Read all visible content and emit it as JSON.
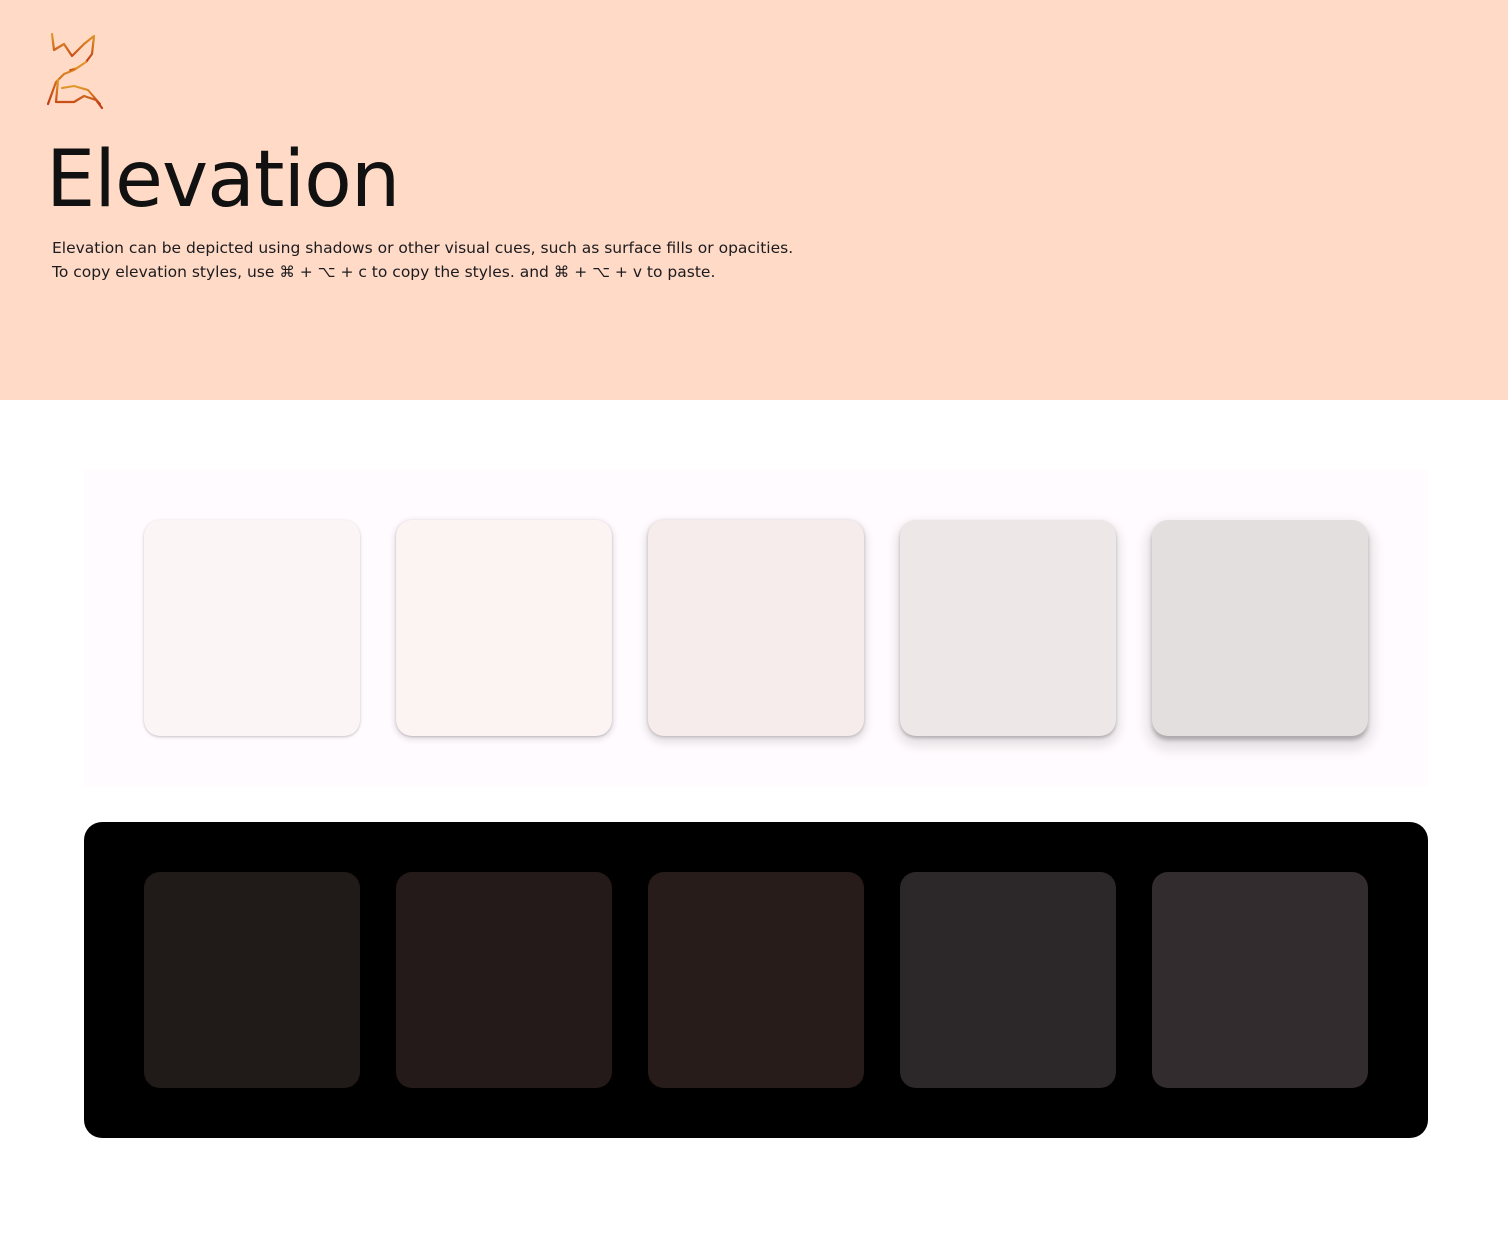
{
  "header": {
    "title": "Elevation",
    "description_line1": "Elevation can be depicted using shadows or other visual cues, such as surface fills or opacities.",
    "description_line2": "To copy elevation styles, use ⌘ + ⌥ + c to copy the styles. and ⌘ + ⌥ + v to paste.",
    "logo_icon": "fox-logo-icon",
    "background_color": "#ffdac6"
  },
  "light_panel": {
    "background_color": "#fffbfe",
    "cards": [
      {
        "color": "#fbf5f6"
      },
      {
        "color": "#fcf3f3"
      },
      {
        "color": "#f5eceb"
      },
      {
        "color": "#eee7e7"
      },
      {
        "color": "#e4dfdf"
      }
    ]
  },
  "dark_panel": {
    "background_color": "#000000",
    "cards": [
      {
        "color": "#201b19"
      },
      {
        "color": "#231a19"
      },
      {
        "color": "#271c19"
      },
      {
        "color": "#2c2729"
      },
      {
        "color": "#332c2e"
      }
    ]
  }
}
